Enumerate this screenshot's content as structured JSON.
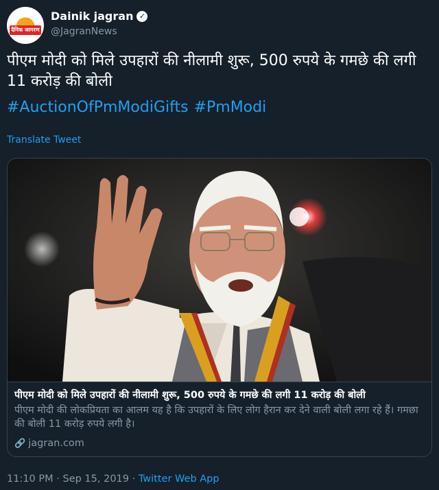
{
  "account": {
    "display_name": "Dainik jagran",
    "handle": "@JagranNews",
    "avatar_text": "दैनिक जागरण",
    "verified_icon": "verified-badge-icon"
  },
  "tweet": {
    "text": "पीएम मोदी को मिले उपहारों की नीलामी शुरू, 500 रुपये के गमछे की लगी 11 करोड़ की बोली",
    "hashtags": [
      "#AuctionOfPmModiGifts",
      "#PmModi"
    ],
    "translate_label": "Translate Tweet"
  },
  "card": {
    "title": "पीएम मोदी को मिले उपहारों की नीलामी शुरू, 500 रुपये के गमछे की लगी 11 करोड़ की बोली",
    "description": "पीएम मोदी की लोकप्रियता का आलम यह है कि उपहारों के लिए लोग हैरान कर देने वाली बोली लगा रहे हैं। गमछा की बोली 11 करोड़ रुपये लगी है।",
    "domain": "jagran.com",
    "link_icon": "link-icon"
  },
  "meta": {
    "time": "11:10 PM",
    "separator1": "·",
    "date": "Sep 15, 2019",
    "separator2": "·",
    "source": "Twitter Web App"
  },
  "colors": {
    "background": "#15202b",
    "accent": "#1da1f2",
    "muted": "#8899a6",
    "border": "#38444d"
  }
}
